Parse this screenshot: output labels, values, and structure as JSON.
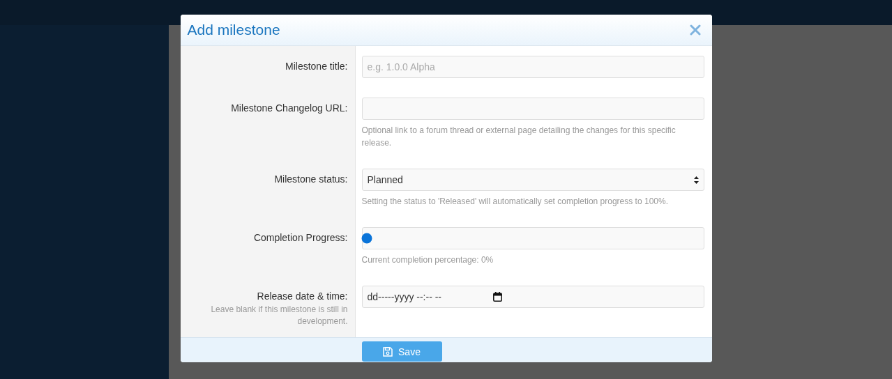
{
  "dialog": {
    "title": "Add milestone"
  },
  "fields": [
    {
      "kind": "text",
      "label": "Milestone title:",
      "placeholder": "e.g. 1.0.0 Alpha"
    },
    {
      "kind": "text",
      "label": "Milestone Changelog URL:",
      "help": "Optional link to a forum thread or external page detailing the changes for this specific release."
    },
    {
      "kind": "select",
      "label": "Milestone status:",
      "value": "Planned",
      "help": "Setting the status to 'Released' will automatically set completion progress to 100%."
    },
    {
      "kind": "slider",
      "label": "Completion Progress:",
      "level": 0,
      "help": "Current completion percentage: 0%"
    },
    {
      "kind": "datetime",
      "label": "Release date & time:",
      "sublabel": "Leave blank if this milestone is still in development.",
      "value": "dd-----yyyy --:-- --"
    }
  ],
  "footer": {
    "save_button": "Save"
  }
}
